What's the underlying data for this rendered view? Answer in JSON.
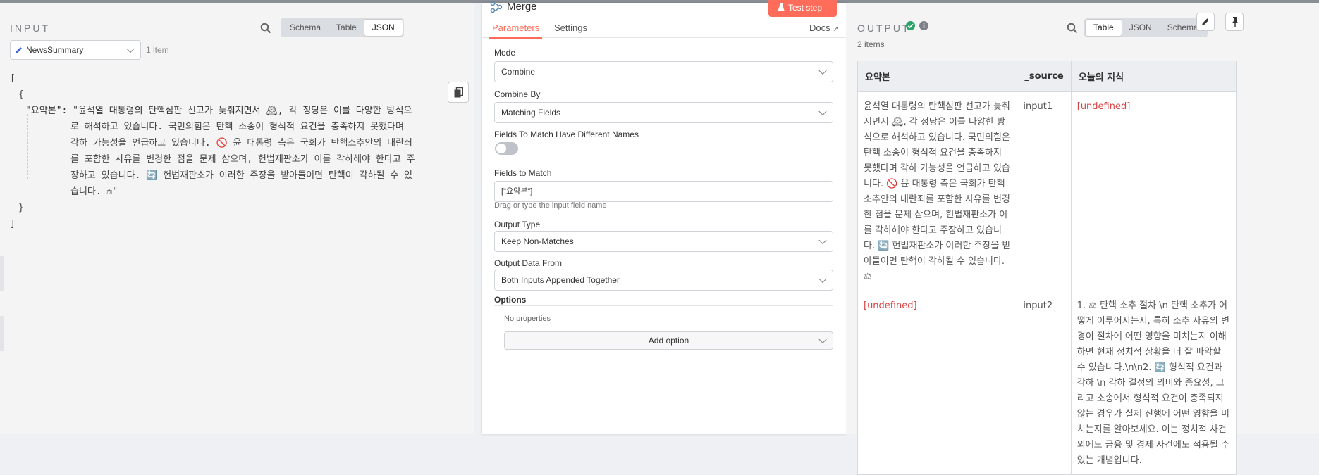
{
  "input": {
    "title": "INPUT",
    "tabs": [
      "Schema",
      "Table",
      "JSON"
    ],
    "active_tab": "JSON",
    "node_select": "NewsSummary",
    "item_count": "1 item",
    "json_lines": [
      "[",
      "{",
      "\"요약본\":  \"윤석열 대통령의 탄핵심판 선고가 늦춰지면서 🕰, 각 정당은 이를 다양한 방식으",
      "로 해석하고 있습니다. 국민의힘은 탄핵 소송이 형식적 요건을 충족하지 못했다며",
      "각하 가능성을 언급하고 있습니다. 🚫 윤 대통령 측은 국회가 탄핵소추안의 내란죄",
      "를 포함한 사유를 변경한 점을 문제 삼으며, 헌법재판소가 이를 각하해야 한다고 주",
      "장하고 있습니다. 🔄 헌법재판소가 이러한 주장을 받아들이면 탄핵이 각하될 수 있",
      "습니다. ⚖\"",
      "}",
      "]"
    ]
  },
  "merge": {
    "title": "Merge",
    "test_step": "Test step",
    "tabs": {
      "parameters": "Parameters",
      "settings": "Settings",
      "docs": "Docs"
    },
    "mode": {
      "label": "Mode",
      "value": "Combine"
    },
    "combine_by": {
      "label": "Combine By",
      "value": "Matching Fields"
    },
    "different_names": {
      "label": "Fields To Match Have Different Names",
      "on": false
    },
    "fields_to_match": {
      "label": "Fields to Match",
      "value": "[\"요약본\"]",
      "hint": "Drag or type the input field name"
    },
    "output_type": {
      "label": "Output Type",
      "value": "Keep Non-Matches"
    },
    "output_data_from": {
      "label": "Output Data From",
      "value": "Both Inputs Appended Together"
    },
    "options": {
      "label": "Options",
      "empty": "No properties",
      "add": "Add option"
    }
  },
  "output": {
    "title": "OUTPUT",
    "tabs": [
      "Table",
      "JSON",
      "Schema"
    ],
    "active_tab": "Table",
    "item_count": "2 items",
    "columns": [
      "요약본",
      "_source",
      "오늘의 지식"
    ],
    "rows": [
      {
        "summary": "윤석열 대통령의 탄핵심판 선고가 늦춰지면서 🕰, 각 정당은 이를 다양한 방식으로 해석하고 있습니다. 국민의힘은 탄핵 소송이 형식적 요건을 충족하지 못했다며 각하 가능성을 언급하고 있습니다. 🚫 윤 대통령 측은 국회가 탄핵소추안의 내란죄를 포함한 사유를 변경한 점을 문제 삼으며, 헌법재판소가 이를 각하해야 한다고 주장하고 있습니다. 🔄 헌법재판소가 이러한 주장을 받아들이면 탄핵이 각하될 수 있습니다. ⚖",
        "source": "input1",
        "knowledge": "[undefined]"
      },
      {
        "summary": "[undefined]",
        "source": "input2",
        "knowledge": "1. ⚖ 탄핵 소추 절차 \\n 탄핵 소추가 어떻게 이루어지는지, 특히 소추 사유의 변경이 절차에 어떤 영향을 미치는지 이해하면 현재 정치적 상황을 더 잘 파악할 수 있습니다.\\n\\n2. 🔄 형식적 요건과 각하 \\n 각하 결정의 의미와 중요성, 그리고 소송에서 형식적 요건이 충족되지 않는 경우가 실제 진행에 어떤 영향을 미치는지를 알아보세요. 이는 정치적 사건 외에도 금융 및 경제 사건에도 적용될 수 있는 개념입니다."
      }
    ]
  },
  "colors": {
    "accent": "#ff6d5a",
    "success": "#29a366",
    "undefined": "#d64545"
  }
}
